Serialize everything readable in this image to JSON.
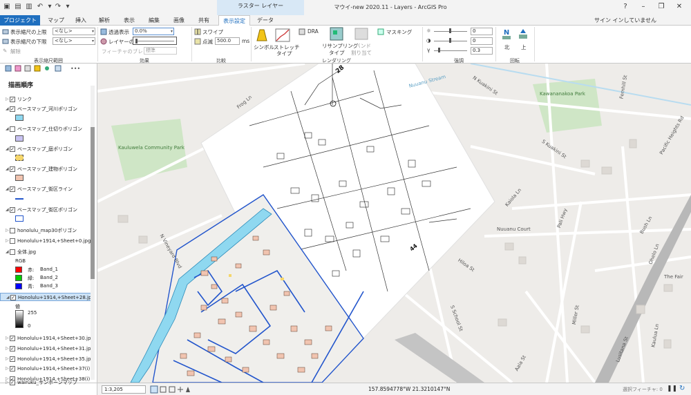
{
  "app": {
    "window_title": "マウイ-new 2020.11 - Layers - ArcGIS Pro",
    "context_tab_group": "ラスター レイヤー",
    "signin_label": "サイン インしていません"
  },
  "tabs": [
    {
      "label": "プロジェクト"
    },
    {
      "label": "マップ"
    },
    {
      "label": "挿入"
    },
    {
      "label": "解析"
    },
    {
      "label": "表示"
    },
    {
      "label": "編集"
    },
    {
      "label": "画像"
    },
    {
      "label": "共有"
    },
    {
      "label": "表示設定"
    },
    {
      "label": "データ"
    }
  ],
  "ribbon": {
    "visibility_range": {
      "upper_label": "表示縮尺の上限",
      "upper_value": "<なし>",
      "lower_label": "表示縮尺の下限",
      "lower_value": "<なし>",
      "clear_label": "解除",
      "caption": "表示縮尺範囲"
    },
    "effects": {
      "transparency_label": "透過表示",
      "transparency_value": "0.0%",
      "layer_blend_label": "レイヤーのブ",
      "feature_blend_label": "フィーチャのブレンド",
      "feature_blend_value": "標準",
      "caption": "効果"
    },
    "compare": {
      "swipe_label": "スワイプ",
      "flicker_label": "点滅",
      "flicker_value": "500.0",
      "flicker_unit": "ms",
      "caption": "比較"
    },
    "rendering": {
      "symbology_label": "シンボル",
      "stretch_label": "ストレッチ",
      "stretch_type_label": "タイプ",
      "dra_label": "DRA",
      "resampling_label": "リサンプリング",
      "resampling_type_label": "タイプ",
      "band_label": "バンド",
      "band_assign_label": "割り当て",
      "masking_label": "マスキング",
      "caption": "レンダリング"
    },
    "enhance": {
      "brightness_value": "0",
      "contrast_value": "0",
      "gamma_value": "0.3",
      "caption": "強調"
    },
    "rotation": {
      "north_label": "北",
      "up_label": "上",
      "caption": "回転"
    }
  },
  "pane": {
    "title": "描画順序",
    "layers": [
      {
        "name": "リンク",
        "checked": true
      },
      {
        "name": "ベースマップ_河川ポリゴン",
        "checked": true
      },
      {
        "name": "ベースマップ_仕切りポリゴン",
        "checked": false
      },
      {
        "name": "ベースマップ_庭ポリゴン",
        "checked": true
      },
      {
        "name": "ベースマップ_建物ポリゴン",
        "checked": true
      },
      {
        "name": "ベースマップ_街区ライン",
        "checked": true
      },
      {
        "name": "ベースマップ_街区ポリゴン",
        "checked": true
      },
      {
        "name": "honolulu_map30ポリゴン",
        "checked": false
      },
      {
        "name": "Honolulu+1914,+Sheet+0.jpg",
        "checked": false
      },
      {
        "name": "全体.jpg",
        "checked": false
      }
    ],
    "rgb_label": "RGB",
    "rgb_bands": [
      {
        "channel": "赤:",
        "band": "Band_1",
        "color": "#ff0000"
      },
      {
        "channel": "緑:",
        "band": "Band_2",
        "color": "#00cc00"
      },
      {
        "channel": "青:",
        "band": "Band_3",
        "color": "#0000ff"
      }
    ],
    "selected_layer": "Honolulu+1914,+Sheet+28.jpg",
    "value_label": "値",
    "value_max": "255",
    "value_min": "0",
    "more_layers": [
      {
        "name": "Honolulu+1914,+Sheet+30.jpg",
        "checked": true
      },
      {
        "name": "Honolulu+1914,+Sheet+31.jpg",
        "checked": true
      },
      {
        "name": "Honolulu+1914,+Sheet+35.jpg",
        "checked": true
      },
      {
        "name": "Honolulu+1914,+Sheet+37(i)",
        "checked": true
      },
      {
        "name": "Honolulu+1914,+Sheet+38(i)",
        "checked": true
      },
      {
        "name": "wairuku_サンボーンマップ",
        "checked": true
      }
    ]
  },
  "map": {
    "street_labels": [
      "Frog Ln",
      "Nuuanu Stream",
      "N Kuakini St",
      "Kawananakoa Park",
      "Kauluwela Community Park",
      "S Kuakini St",
      "Pacific Heights Rd",
      "Nuuanu Court",
      "Pali Hwy",
      "Bush Ln",
      "Ohelo Ln",
      "The Fair",
      "Hiloa St",
      "S School St",
      "Lusitana St",
      "Miller St",
      "Kaiola Ln",
      "Fernhill St",
      "Kaulua Ln",
      "Aala St",
      "N Vineyard Blvd"
    ],
    "sheet_labels": [
      "28",
      "44"
    ]
  },
  "status": {
    "scale": "1:3,205",
    "coordinates": "157.8594778°W 21.3210147°N",
    "selected_features": "選択フィーチャ: 0"
  }
}
